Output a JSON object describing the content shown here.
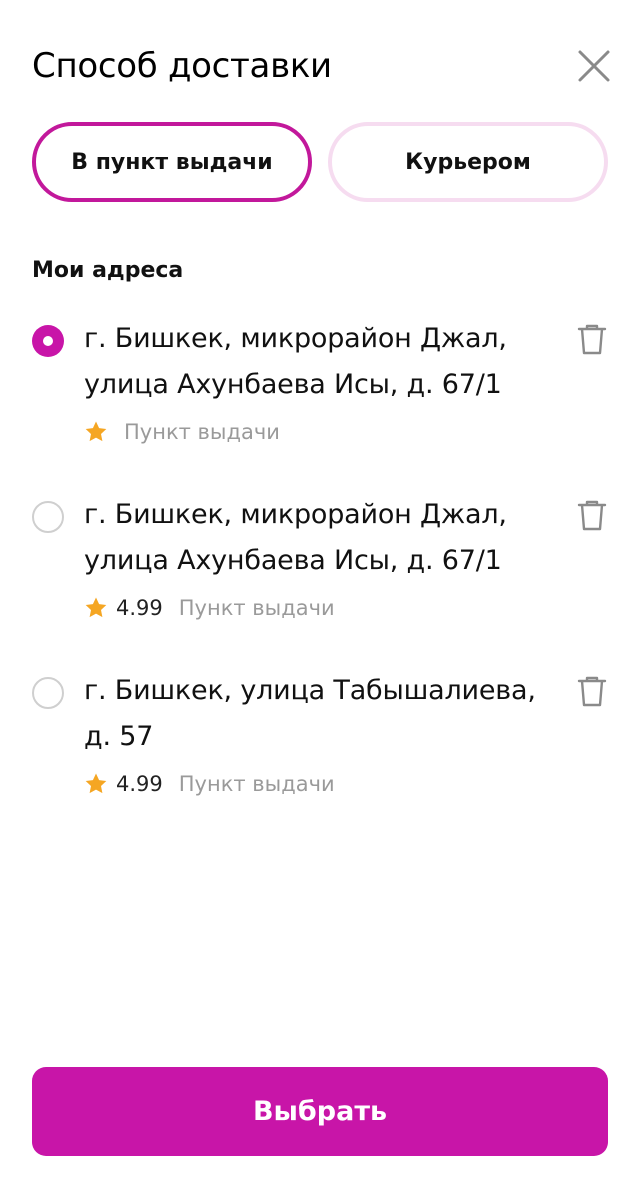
{
  "header": {
    "title": "Способ доставки",
    "close_icon": "close-icon"
  },
  "tabs": [
    {
      "label": "В пункт выдачи",
      "active": true
    },
    {
      "label": "Курьером",
      "active": false
    }
  ],
  "section": {
    "title": "Мои адреса"
  },
  "addresses": [
    {
      "line1": "г. Бишкек, микрорайон Джал,",
      "line2": "улица Ахунбаева Исы, д. 67/1",
      "rating": "",
      "type": "Пункт выдачи",
      "selected": true
    },
    {
      "line1": "г. Бишкек, микрорайон Джал,",
      "line2": "улица Ахунбаева Исы, д. 67/1",
      "rating": "4.99",
      "type": "Пункт выдачи",
      "selected": false
    },
    {
      "line1": "г. Бишкек, улица Табышалиева,",
      "line2": "д. 57",
      "rating": "4.99",
      "type": "Пункт выдачи",
      "selected": false
    }
  ],
  "footer": {
    "button_label": "Выбрать"
  },
  "colors": {
    "accent": "#c815a8",
    "accent_light": "#f6dcf0",
    "star": "#f5a623",
    "muted": "#9a9a9a"
  },
  "icons": [
    "close-icon",
    "radio-selected-icon",
    "radio-unselected-icon",
    "star-icon",
    "trash-icon"
  ]
}
